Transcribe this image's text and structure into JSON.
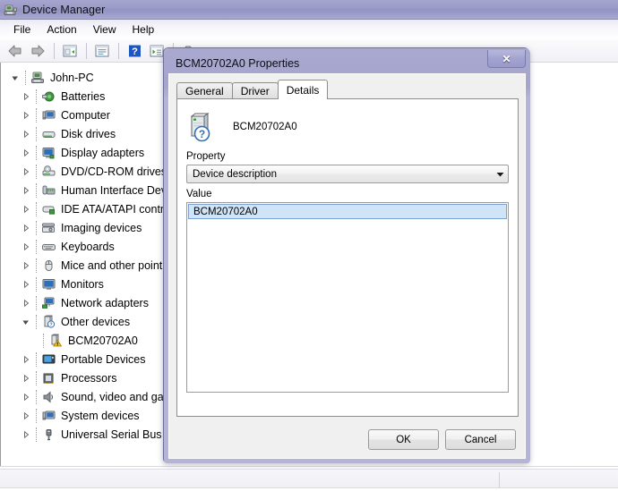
{
  "window": {
    "title": "Device Manager",
    "icon": "device-manager-icon"
  },
  "menubar": {
    "items": [
      {
        "label": "File"
      },
      {
        "label": "Action"
      },
      {
        "label": "View"
      },
      {
        "label": "Help"
      }
    ]
  },
  "toolbar": {
    "buttons": [
      {
        "name": "back-icon"
      },
      {
        "name": "forward-icon"
      },
      {
        "name": "separator"
      },
      {
        "name": "show-hidden-devices-icon"
      },
      {
        "name": "separator"
      },
      {
        "name": "properties-icon"
      },
      {
        "name": "separator"
      },
      {
        "name": "help-icon"
      },
      {
        "name": "scan-hardware-icon"
      },
      {
        "name": "separator"
      },
      {
        "name": "update-driver-icon"
      }
    ]
  },
  "tree": {
    "root": {
      "label": "John-PC",
      "icon": "computer-icon",
      "expanded": true
    },
    "items": [
      {
        "label": "Batteries",
        "icon": "battery-icon",
        "expanded": false
      },
      {
        "label": "Computer",
        "icon": "computer-node-icon",
        "expanded": false
      },
      {
        "label": "Disk drives",
        "icon": "disk-drive-icon",
        "expanded": false
      },
      {
        "label": "Display adapters",
        "icon": "display-adapter-icon",
        "expanded": false
      },
      {
        "label": "DVD/CD-ROM drives",
        "icon": "dvd-drive-icon",
        "expanded": false
      },
      {
        "label": "Human Interface Devices",
        "icon": "hid-icon",
        "expanded": false
      },
      {
        "label": "IDE ATA/ATAPI controllers",
        "icon": "ide-controller-icon",
        "expanded": false
      },
      {
        "label": "Imaging devices",
        "icon": "imaging-device-icon",
        "expanded": false
      },
      {
        "label": "Keyboards",
        "icon": "keyboard-icon",
        "expanded": false
      },
      {
        "label": "Mice and other pointing devices",
        "icon": "mouse-icon",
        "expanded": false
      },
      {
        "label": "Monitors",
        "icon": "monitor-icon",
        "expanded": false
      },
      {
        "label": "Network adapters",
        "icon": "network-adapter-icon",
        "expanded": false
      },
      {
        "label": "Other devices",
        "icon": "unknown-device-icon",
        "expanded": true
      },
      {
        "label": "Portable Devices",
        "icon": "portable-device-icon",
        "expanded": false
      },
      {
        "label": "Processors",
        "icon": "processor-icon",
        "expanded": false
      },
      {
        "label": "Sound, video and game controllers",
        "icon": "sound-device-icon",
        "expanded": false
      },
      {
        "label": "System devices",
        "icon": "system-device-icon",
        "expanded": false
      },
      {
        "label": "Universal Serial Bus controllers",
        "icon": "usb-controller-icon",
        "expanded": false
      }
    ],
    "child": {
      "label": "BCM20702A0",
      "icon": "warning-device-icon",
      "parent": "Other devices"
    }
  },
  "statusbar": {
    "text": ""
  },
  "dialog": {
    "title": "BCM20702A0 Properties",
    "close_label": "✕",
    "tabs": [
      {
        "label": "General",
        "active": false
      },
      {
        "label": "Driver",
        "active": false
      },
      {
        "label": "Details",
        "active": true
      }
    ],
    "device_name": "BCM20702A0",
    "device_icon": "unknown-device-large-icon",
    "property_label": "Property",
    "property_selected": "Device description",
    "value_label": "Value",
    "value_rows": [
      "BCM20702A0"
    ],
    "ok_label": "OK",
    "cancel_label": "Cancel"
  },
  "colors": {
    "titlebar": "#9a9ac8",
    "dialog_frame": "#b4b4d8",
    "selection": "#cfe4f7",
    "warning": "#f5c518"
  }
}
